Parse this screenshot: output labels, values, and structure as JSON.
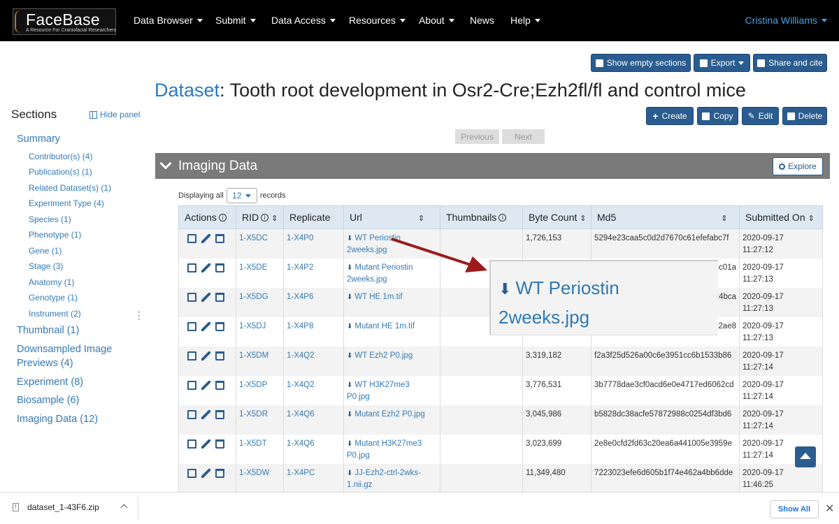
{
  "navbar": {
    "logo_main": "FaceBase",
    "logo_sub": "A Resource For Craniofacial Researchers",
    "items": [
      {
        "label": "Data Browser",
        "caret": true
      },
      {
        "label": "Submit",
        "caret": true
      },
      {
        "label": "Data Access",
        "caret": true
      },
      {
        "label": "Resources",
        "caret": true
      },
      {
        "label": "About",
        "caret": true
      },
      {
        "label": "News",
        "caret": false
      },
      {
        "label": "Help",
        "caret": true
      }
    ],
    "user": "Cristina Williams"
  },
  "top_actions": {
    "show_empty": "Show empty sections",
    "export": "Export",
    "share": "Share and cite"
  },
  "title": {
    "type_link": "Dataset",
    "text": ": Tooth root development in Osr2-Cre;Ezh2fl/fl and control mice"
  },
  "record_actions": {
    "create": "Create",
    "copy": "Copy",
    "edit": "Edit",
    "delete": "Delete"
  },
  "pager": {
    "previous": "Previous",
    "next": "Next"
  },
  "sidebar": {
    "title": "Sections",
    "hide_panel": "Hide panel",
    "items": [
      {
        "label": "Summary",
        "level": "main"
      },
      {
        "label": "Contributor(s) (4)",
        "level": "sub"
      },
      {
        "label": "Publication(s) (1)",
        "level": "sub"
      },
      {
        "label": "Related Dataset(s) (1)",
        "level": "sub"
      },
      {
        "label": "Experiment Type (4)",
        "level": "sub"
      },
      {
        "label": "Species (1)",
        "level": "sub"
      },
      {
        "label": "Phenotype (1)",
        "level": "sub"
      },
      {
        "label": "Gene (1)",
        "level": "sub"
      },
      {
        "label": "Stage (3)",
        "level": "sub"
      },
      {
        "label": "Anatomy (1)",
        "level": "sub"
      },
      {
        "label": "Genotype (1)",
        "level": "sub"
      },
      {
        "label": "Instrument (2)",
        "level": "sub"
      },
      {
        "label": "Thumbnail (1)",
        "level": "main"
      },
      {
        "label": "Downsampled Image",
        "level": "main"
      },
      {
        "label": "Previews (4)",
        "level": "main"
      },
      {
        "label": "Experiment (8)",
        "level": "main"
      },
      {
        "label": "Biosample (6)",
        "level": "main"
      },
      {
        "label": "Imaging Data (12)",
        "level": "main"
      }
    ]
  },
  "section": {
    "title": "Imaging Data",
    "explore": "Explore",
    "displaying_prefix": "Displaying all",
    "page_size": "12",
    "displaying_suffix": "records"
  },
  "table": {
    "headers": [
      "Actions",
      "RID",
      "Replicate",
      "Url",
      "Thumbnails",
      "Byte Count",
      "Md5",
      "Submitted On"
    ],
    "rows": [
      {
        "rid": "1-X5DC",
        "replicate": "1-X4P0",
        "url": [
          "WT Periostin",
          "2weeks.jpg"
        ],
        "bytes": "1,726,153",
        "md5": "5294e23caa5c0d2d7670c61efefabc7f",
        "submitted": [
          "2020-09-17",
          "11:27:12"
        ]
      },
      {
        "rid": "1-X5DE",
        "replicate": "1-X4P2",
        "url": [
          "Mutant Periostin",
          "2weeks.jpg"
        ],
        "bytes": "",
        "md5": "4c01a",
        "submitted": [
          "2020-09-17",
          "11:27:13"
        ]
      },
      {
        "rid": "1-X5DG",
        "replicate": "1-X4P6",
        "url": [
          "WT HE 1m.tif",
          ""
        ],
        "bytes": "",
        "md5": "24bca",
        "submitted": [
          "2020-09-17",
          "11:27:13"
        ]
      },
      {
        "rid": "1-X5DJ",
        "replicate": "1-X4P8",
        "url": [
          "Mutant HE 1m.tif",
          ""
        ],
        "bytes": "",
        "md5": "2ae8",
        "submitted": [
          "2020-09-17",
          "11:27:13"
        ]
      },
      {
        "rid": "1-X5DM",
        "replicate": "1-X4Q2",
        "url": [
          "WT Ezh2 P0.jpg",
          ""
        ],
        "bytes": "3,319,182",
        "md5": "f2a3f25d526a00c6e3951cc6b1533b86",
        "submitted": [
          "2020-09-17",
          "11:27:14"
        ]
      },
      {
        "rid": "1-X5DP",
        "replicate": "1-X4Q2",
        "url": [
          "WT H3K27me3",
          "P0.jpg"
        ],
        "bytes": "3,776,531",
        "md5": "3b7778dae3cf0acd6e0e4717ed6062cd",
        "submitted": [
          "2020-09-17",
          "11:27:14"
        ]
      },
      {
        "rid": "1-X5DR",
        "replicate": "1-X4Q6",
        "url": [
          "Mutant Ezh2 P0.jpg",
          ""
        ],
        "bytes": "3,045,986",
        "md5": "b5828dc38acfe57872988c0254df3bd6",
        "submitted": [
          "2020-09-17",
          "11:27:14"
        ]
      },
      {
        "rid": "1-X5DT",
        "replicate": "1-X4Q6",
        "url": [
          "Mutant H3K27me3",
          "P0.jpg"
        ],
        "bytes": "3,023,699",
        "md5": "2e8e0cfd2fd63c20ea6a441005e3959e",
        "submitted": [
          "2020-09-17",
          "11:27:14"
        ]
      },
      {
        "rid": "1-X5DW",
        "replicate": "1-X4PC",
        "url": [
          "JJ-Ezh2-ctrl-2wks-",
          "1.nii.gz"
        ],
        "bytes": "11,349,480",
        "md5": "7223023efe6d605b1f74e462a4bb6dde",
        "submitted": [
          "2020-09-17",
          "11:46:25"
        ]
      }
    ]
  },
  "zoom_callout": {
    "line1": "WT Periostin",
    "line2": "2weeks.jpg"
  },
  "download_bar": {
    "filename": "dataset_1-43F6.zip",
    "show_all": "Show All",
    "close": "✕"
  },
  "colors": {
    "navbar": "#000000",
    "primary_button": "#2b5c8f",
    "link": "#337ab7",
    "section_header": "#7a7a7a",
    "table_header": "#dde8f3",
    "arrow": "#9b1b1b"
  }
}
